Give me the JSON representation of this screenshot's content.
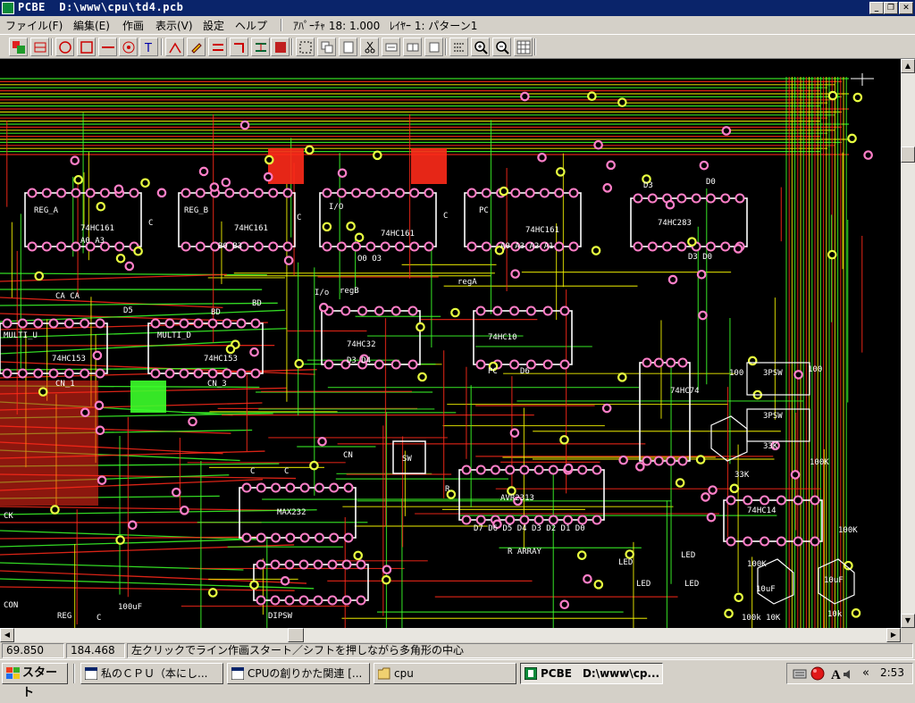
{
  "window": {
    "app": "PCBE",
    "path": "D:\\www\\cpu\\td4.pcb"
  },
  "menu": {
    "items": [
      "ファイル(F)",
      "編集(E)",
      "作画",
      "表示(V)",
      "設定",
      "ヘルプ"
    ],
    "aperture": "ｱﾊﾟｰﾁｬ 18: 1.000",
    "layer": "ﾚｲﾔｰ 1: パターン1"
  },
  "toolbar": {
    "icons": [
      "layer-color-icon",
      "layer-select-icon",
      "circle-pad-icon",
      "square-pad-icon",
      "line-icon",
      "target-icon",
      "text-icon",
      "angle-icon",
      "paint-icon",
      "bus-icon",
      "turn-icon",
      "parallel-icon",
      "fill-icon",
      "select-icon",
      "copy-icon",
      "paste-icon",
      "cut-icon",
      "move-icon",
      "mirror-icon",
      "rotate-icon",
      "measure-icon",
      "zoom-in-icon",
      "zoom-out-icon",
      "grid-icon"
    ]
  },
  "board": {
    "labels": [
      {
        "t": "REG_A"
      },
      {
        "t": "74HC161"
      },
      {
        "t": "A0 A3"
      },
      {
        "t": "C"
      },
      {
        "t": "REG_B"
      },
      {
        "t": "74HC161"
      },
      {
        "t": "B0 B3"
      },
      {
        "t": "C"
      },
      {
        "t": "I/O"
      },
      {
        "t": "74HC161"
      },
      {
        "t": "O0 O3"
      },
      {
        "t": "C"
      },
      {
        "t": "PC"
      },
      {
        "t": "74HC161"
      },
      {
        "t": "A0 A3 A2 A1"
      },
      {
        "t": "74HC283"
      },
      {
        "t": "D3"
      },
      {
        "t": "D0"
      },
      {
        "t": "D3 D0"
      },
      {
        "t": "I/o"
      },
      {
        "t": "regB"
      },
      {
        "t": "regA"
      },
      {
        "t": "74HC32"
      },
      {
        "t": "D3 D4"
      },
      {
        "t": "74HC10"
      },
      {
        "t": "PC"
      },
      {
        "t": "D6"
      },
      {
        "t": "MULTI_U"
      },
      {
        "t": "74HC153"
      },
      {
        "t": "MULTI_D"
      },
      {
        "t": "74HC153"
      },
      {
        "t": "CA CA"
      },
      {
        "t": "D5"
      },
      {
        "t": "BD"
      },
      {
        "t": "BD"
      },
      {
        "t": "CN_1"
      },
      {
        "t": "CN_3"
      },
      {
        "t": "SW"
      },
      {
        "t": "CN"
      },
      {
        "t": "C"
      },
      {
        "t": "C"
      },
      {
        "t": "MAX232"
      },
      {
        "t": "R"
      },
      {
        "t": "AVR2313"
      },
      {
        "t": "D7 D6 D5 D4 D3 D2 D1 D0"
      },
      {
        "t": "R ARRAY"
      },
      {
        "t": "74HC74"
      },
      {
        "t": "3PSW"
      },
      {
        "t": "3PSW"
      },
      {
        "t": "100"
      },
      {
        "t": "100"
      },
      {
        "t": "33K"
      },
      {
        "t": "33K"
      },
      {
        "t": "100K"
      },
      {
        "t": "74HC14"
      },
      {
        "t": "100K"
      },
      {
        "t": "LED"
      },
      {
        "t": "LED"
      },
      {
        "t": "LED"
      },
      {
        "t": "LED"
      },
      {
        "t": "100K"
      },
      {
        "t": "10uF"
      },
      {
        "t": "10uF"
      },
      {
        "t": "100k 10K"
      },
      {
        "t": "10k"
      },
      {
        "t": "DIPSW"
      },
      {
        "t": "REG"
      },
      {
        "t": "CON"
      },
      {
        "t": "C"
      },
      {
        "t": "100uF"
      },
      {
        "t": "CK"
      }
    ]
  },
  "status": {
    "x": "69.850",
    "y": "184.468",
    "message": "左クリックでライン作画スタート／シフトを押しながら多角形の中心"
  },
  "taskbar": {
    "start": "スタート",
    "tasks": [
      {
        "label": "私のＣＰＵ（本にし..."
      },
      {
        "label": "CPUの創りかた関連 [..."
      },
      {
        "label": "cpu"
      },
      {
        "label": "PCBE　D:\\www\\cp..."
      }
    ],
    "clock": "2:53",
    "chevron": "«"
  },
  "colors": {
    "titlebar": "#0a246a",
    "pcb_bg": "#000000",
    "trace_red": "#ff2a1a",
    "trace_green": "#3cff2a",
    "trace_yellow": "#f0f000",
    "pad": "#ff7fc8"
  }
}
